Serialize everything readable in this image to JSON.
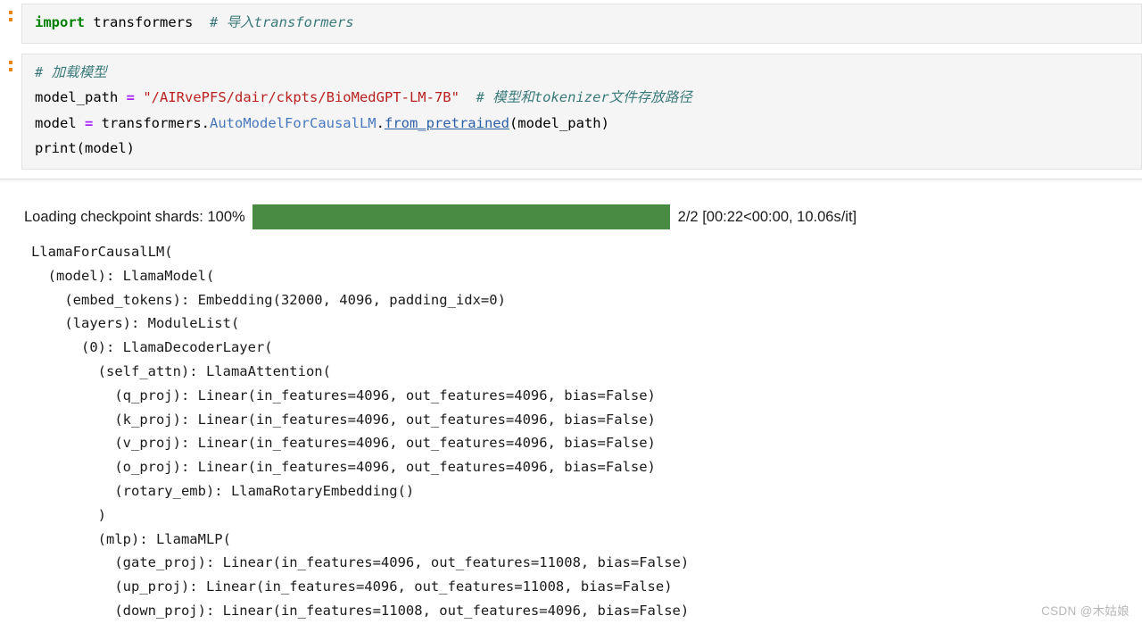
{
  "cells": [
    {
      "prompt": ":",
      "lines": [
        [
          {
            "t": "import",
            "c": "kw"
          },
          {
            "t": " transformers  ",
            "c": "plain"
          },
          {
            "t": "# 导入transformers",
            "c": "comment"
          }
        ]
      ]
    },
    {
      "prompt": ":",
      "lines": [
        [
          {
            "t": "# 加载模型",
            "c": "comment"
          }
        ],
        [
          {
            "t": "model_path ",
            "c": "plain"
          },
          {
            "t": "=",
            "c": "op"
          },
          {
            "t": " ",
            "c": "plain"
          },
          {
            "t": "\"/AIRvePFS/dair/ckpts/BioMedGPT-LM-7B\"",
            "c": "string"
          },
          {
            "t": "  ",
            "c": "plain"
          },
          {
            "t": "# 模型和tokenizer文件存放路径",
            "c": "comment"
          }
        ],
        [
          {
            "t": "model ",
            "c": "plain"
          },
          {
            "t": "=",
            "c": "op"
          },
          {
            "t": " transformers.",
            "c": "plain"
          },
          {
            "t": "AutoModelForCausalLM",
            "c": "class"
          },
          {
            "t": ".",
            "c": "plain"
          },
          {
            "t": "from_pretrained",
            "c": "func"
          },
          {
            "t": "(model_path)",
            "c": "plain"
          }
        ],
        [
          {
            "t": "print(model)",
            "c": "plain"
          }
        ]
      ]
    }
  ],
  "output": {
    "progress": {
      "label": "Loading checkpoint shards: 100%",
      "percent": 100,
      "bar_color": "#4a8b44",
      "stats": "2/2 [00:22<00:00, 10.06s/it]"
    },
    "model_dump": "LlamaForCausalLM(\n  (model): LlamaModel(\n    (embed_tokens): Embedding(32000, 4096, padding_idx=0)\n    (layers): ModuleList(\n      (0): LlamaDecoderLayer(\n        (self_attn): LlamaAttention(\n          (q_proj): Linear(in_features=4096, out_features=4096, bias=False)\n          (k_proj): Linear(in_features=4096, out_features=4096, bias=False)\n          (v_proj): Linear(in_features=4096, out_features=4096, bias=False)\n          (o_proj): Linear(in_features=4096, out_features=4096, bias=False)\n          (rotary_emb): LlamaRotaryEmbedding()\n        )\n        (mlp): LlamaMLP(\n          (gate_proj): Linear(in_features=4096, out_features=11008, bias=False)\n          (up_proj): Linear(in_features=4096, out_features=11008, bias=False)\n          (down_proj): Linear(in_features=11008, out_features=4096, bias=False)"
  },
  "watermark": "CSDN @木姑娘"
}
